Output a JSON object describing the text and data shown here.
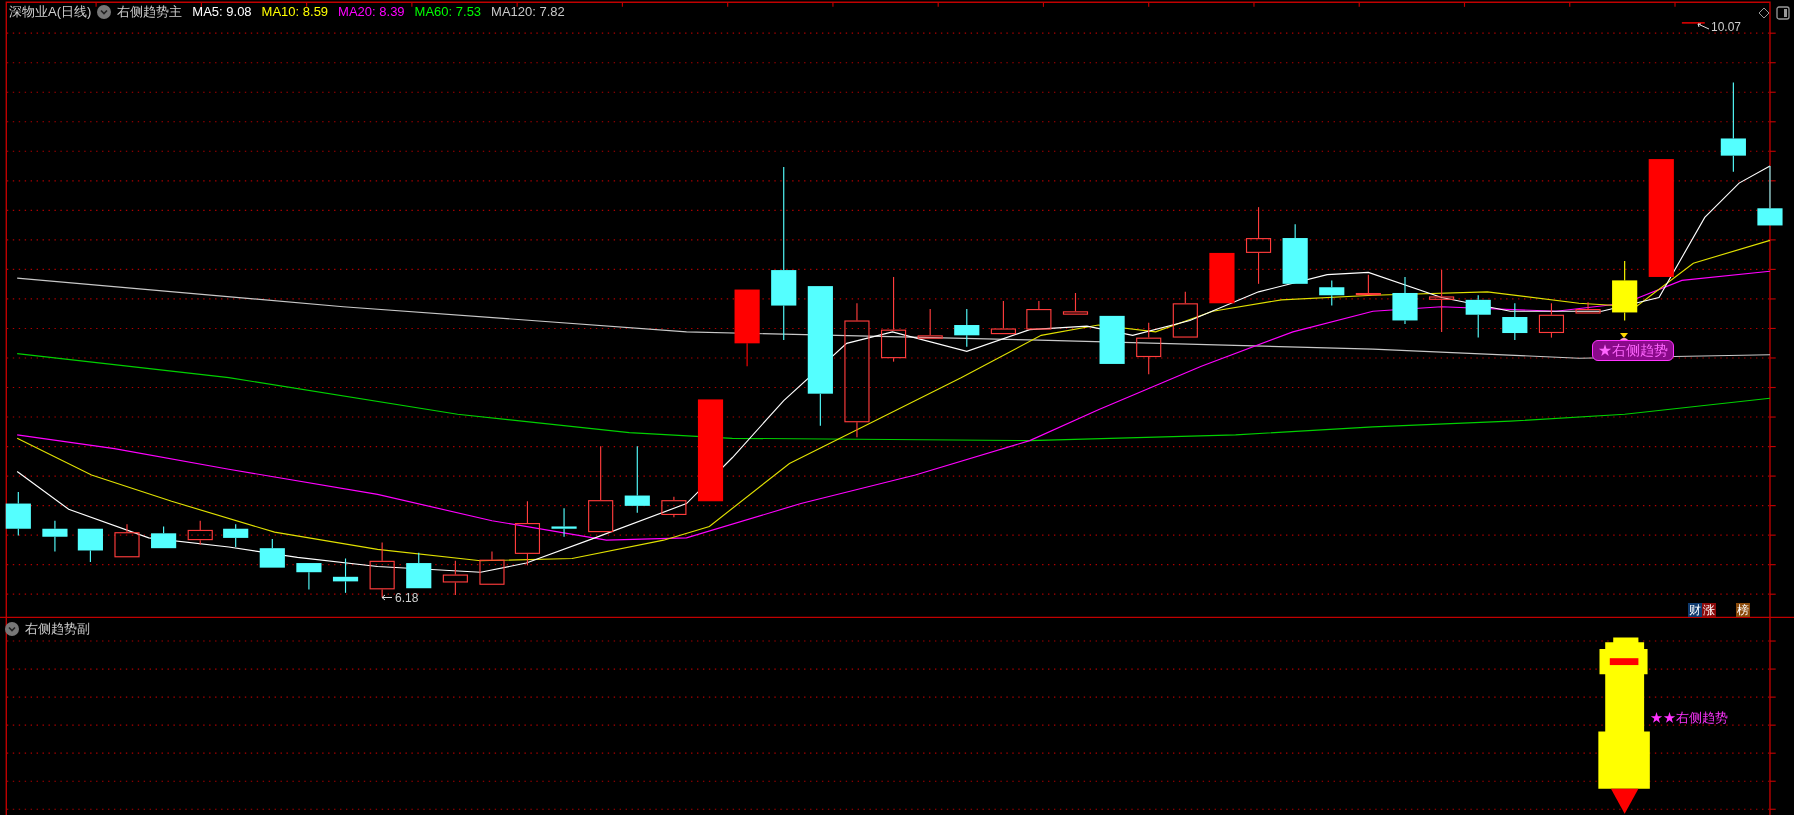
{
  "main_chart": {
    "title": "深物业A(日线)",
    "indicator": "右侧趋势主",
    "ma_legend": [
      {
        "text": "MA5: 9.08",
        "color": "#ffffff"
      },
      {
        "text": "MA10: 8.59",
        "color": "#ffff00"
      },
      {
        "text": "MA20: 8.39",
        "color": "#ff00ff"
      },
      {
        "text": "MA60: 7.53",
        "color": "#00ff00"
      },
      {
        "text": "MA120: 7.82",
        "color": "#c8c8c8"
      }
    ],
    "high_label": "10.07",
    "low_label": "6.18",
    "signal_label": "★右侧趋势",
    "badges": [
      {
        "text": "财",
        "color": "#0f3a6e"
      },
      {
        "text": "涨",
        "color": "#8c0a0a"
      },
      {
        "text": "榜",
        "color": "#8a4a0a"
      }
    ]
  },
  "sub_chart": {
    "indicator": "右侧趋势副",
    "signal_label": "★★右侧趋势"
  }
}
